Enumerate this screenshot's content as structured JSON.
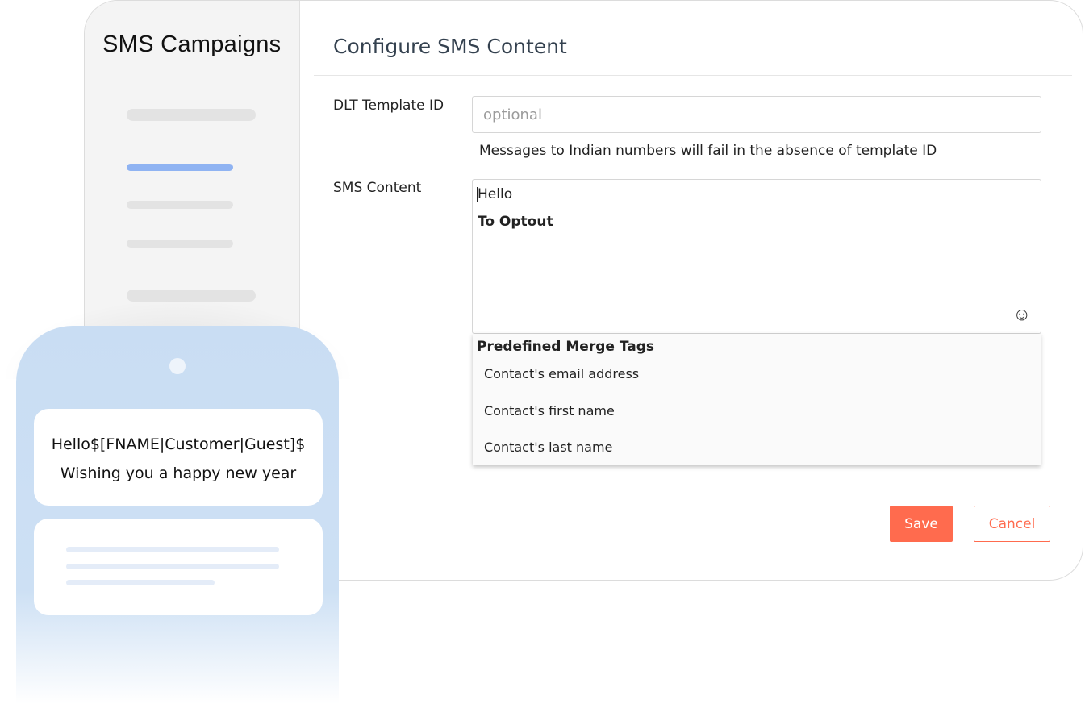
{
  "sidebar": {
    "title": "SMS Campaigns"
  },
  "main": {
    "title": "Configure SMS Content",
    "dlt": {
      "label": "DLT Template ID",
      "placeholder": "optional",
      "hint": "Messages to Indian numbers will fail in the absence of template ID"
    },
    "sms": {
      "label": "SMS Content",
      "line1": "Hello",
      "line2": "To Optout",
      "emoji_icon": "smiley-icon"
    },
    "merge_tags": {
      "header": "Predefined Merge Tags",
      "items": [
        "Contact's email address",
        "Contact's first name",
        "Contact's last name"
      ]
    },
    "buttons": {
      "save": "Save",
      "cancel": "Cancel"
    }
  },
  "phone": {
    "message_line1": "Hello$[FNAME|Customer|Guest]$",
    "message_line2": "Wishing you a happy new year"
  },
  "colors": {
    "accent": "#ff6b4e",
    "sidebar_active": "#8fb3f2",
    "phone_bg": "#c9ddf3"
  }
}
